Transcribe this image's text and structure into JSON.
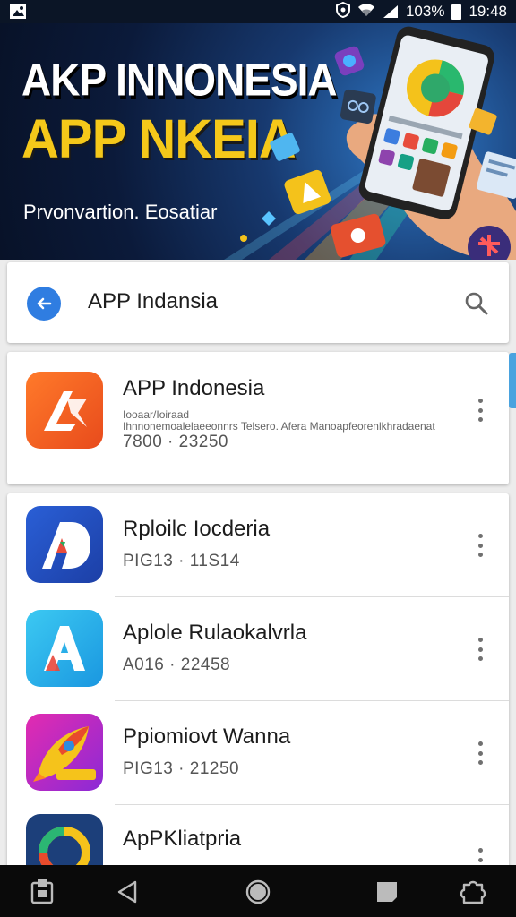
{
  "status_bar": {
    "battery_text": "103%",
    "time": "19:48",
    "icons": [
      "gallery-icon",
      "shield-icon",
      "wifi-icon",
      "signal-icon",
      "battery-icon"
    ]
  },
  "banner": {
    "title_line1": "AKP INNONESIA",
    "title_line2": "APP NKEIA",
    "subtitle": "Prvonvartion. Eosatiar"
  },
  "search": {
    "query": "APP Indansia"
  },
  "apps": [
    {
      "title": "APP  Indonesia",
      "developer_line1": "Iooaar/Ioiraad",
      "developer_line2": "Ihnnonemoalelaeeonnrs Telsero.  Afera  Manoapfeorenlkhradaenat",
      "meta": "7800 · 23250",
      "icon": "app-logo-orange"
    },
    {
      "title": "Rploilc Iocderia",
      "meta": "PIG13 · 11S14",
      "icon": "app-logo-blue-a"
    },
    {
      "title": "Aplole Rulaokalvrla",
      "meta": "A016 · 22458",
      "icon": "app-logo-cyan-a"
    },
    {
      "title": "Ppiomiovt Wanna",
      "meta": "PIG13 · 21250",
      "icon": "app-logo-rocket"
    },
    {
      "title": "ApPKliatpria",
      "meta": "",
      "icon": "app-logo-ring"
    }
  ],
  "colors": {
    "accent_blue": "#2f7de1",
    "banner_yellow": "#f5c81a",
    "nav_bar": "#0a0a0a"
  },
  "nav_bar": {
    "icons": [
      "recents-app-icon",
      "back-icon",
      "home-icon",
      "square-icon",
      "puzzle-icon"
    ]
  }
}
